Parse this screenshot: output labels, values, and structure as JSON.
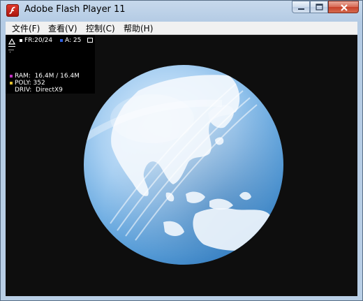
{
  "window": {
    "title": "Adobe Flash Player 11",
    "icon": "flash-icon",
    "controls": [
      "minimize-icon",
      "maximize-icon",
      "close-icon"
    ]
  },
  "menu": [
    "文件(F)",
    "查看(V)",
    "控制(C)",
    "帮助(H)"
  ],
  "stats": {
    "fps": "FR:20/24",
    "alpha": "A: 25",
    "ram_label": "RAM:",
    "ram_value": "16.4M / 16.4M",
    "poly_label": "POLY:",
    "poly_value": "352",
    "driv_label": "DRIV:",
    "driv_value": "DirectX9"
  },
  "colors": {
    "stage_bg": "#0e0e0e",
    "globe_light": "#dfefff",
    "globe_dark": "#2f7fc8",
    "land": "#f4f8fd",
    "ram_square": "#c030c0",
    "poly_square": "#e0c030",
    "fps_square": "#ffffff",
    "alpha_square": "#3060e0"
  }
}
